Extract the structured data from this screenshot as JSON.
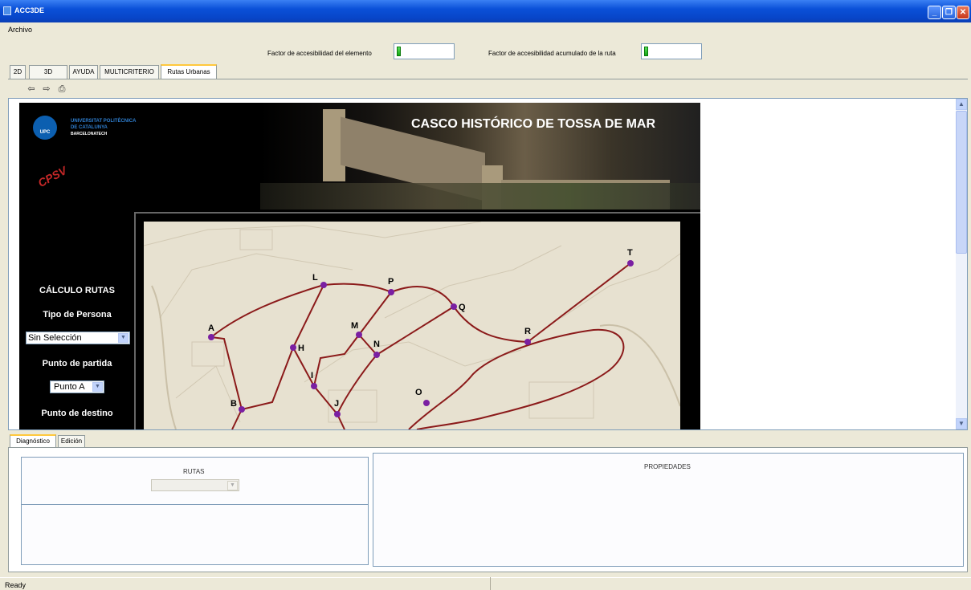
{
  "window": {
    "title": "ACC3DE"
  },
  "menu": {
    "archivo": "Archivo"
  },
  "meters": {
    "element_label": "Factor de accesibilidad del elemento",
    "route_label": "Factor de accesibilidad acumulado de la ruta"
  },
  "tabs": [
    "2D",
    "3D",
    "AYUDA",
    "MULTICRITERIO",
    "Rutas Urbanas"
  ],
  "toolbar": {
    "back_icon": "⇦",
    "forward_icon": "⇨",
    "print_icon": "⎙"
  },
  "webpage": {
    "banner_title": "CASCO HISTÓRICO DE TOSSA DE MAR",
    "upc_line1": "UNIVERSITAT POLITÈCNICA",
    "upc_line2": "DE CATALUNYA",
    "upc_line3": "BARCELONATECH",
    "upc_badge": "UPC",
    "cpsv": "CPSV",
    "calculo_rutas": "CÁLCULO RUTAS",
    "tipo_persona": "Tipo de Persona",
    "tipo_persona_value": "Sin Selección",
    "punto_partida": "Punto de partida",
    "punto_partida_value": "Punto A",
    "punto_destino": "Punto de destino"
  },
  "map_nodes": [
    "A",
    "B",
    "H",
    "I",
    "J",
    "L",
    "M",
    "N",
    "O",
    "P",
    "Q",
    "R",
    "T"
  ],
  "bottom_tabs": [
    "Diagnóstico",
    "Edición"
  ],
  "bottom": {
    "rutas": "RUTAS",
    "propiedades": "PROPIEDADES"
  },
  "status": {
    "text": "Ready"
  },
  "colors": {
    "route": "#8b1a1a",
    "node": "#7a1fa2",
    "titlebar": "#0a50d8"
  }
}
